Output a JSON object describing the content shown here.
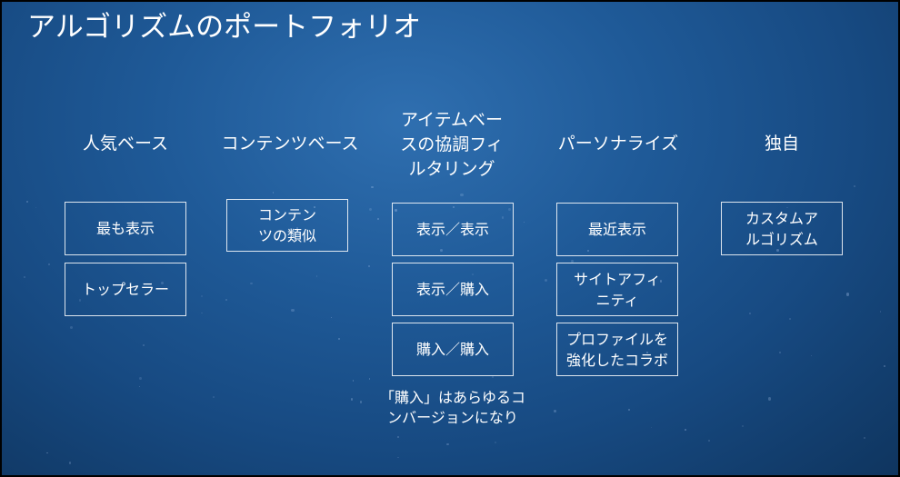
{
  "slide": {
    "title": "アルゴリズムのポートフォリオ"
  },
  "columns": [
    {
      "heading": "人気ベース",
      "items": [
        "最も表示",
        "トップセラー"
      ]
    },
    {
      "heading": "コンテンツベース",
      "items": [
        "コンテン\nツの類似"
      ]
    },
    {
      "heading": "アイテムベー\nスの協調フィ\nルタリング",
      "items": [
        "表示／表示",
        "表示／購入",
        "購入／購入"
      ],
      "note": "「購入」はあらゆるコ\nンバージョンになり"
    },
    {
      "heading": "パーソナライズ",
      "items": [
        "最近表示",
        "サイトアフィ\nニティ",
        "プロファイルを\n強化したコラボ"
      ]
    },
    {
      "heading": "独自",
      "items": [
        "カスタムア\nルゴリズム"
      ]
    }
  ],
  "colors": {
    "background": "#1f5a98",
    "text": "#ffffff",
    "border": "#ffffff"
  }
}
